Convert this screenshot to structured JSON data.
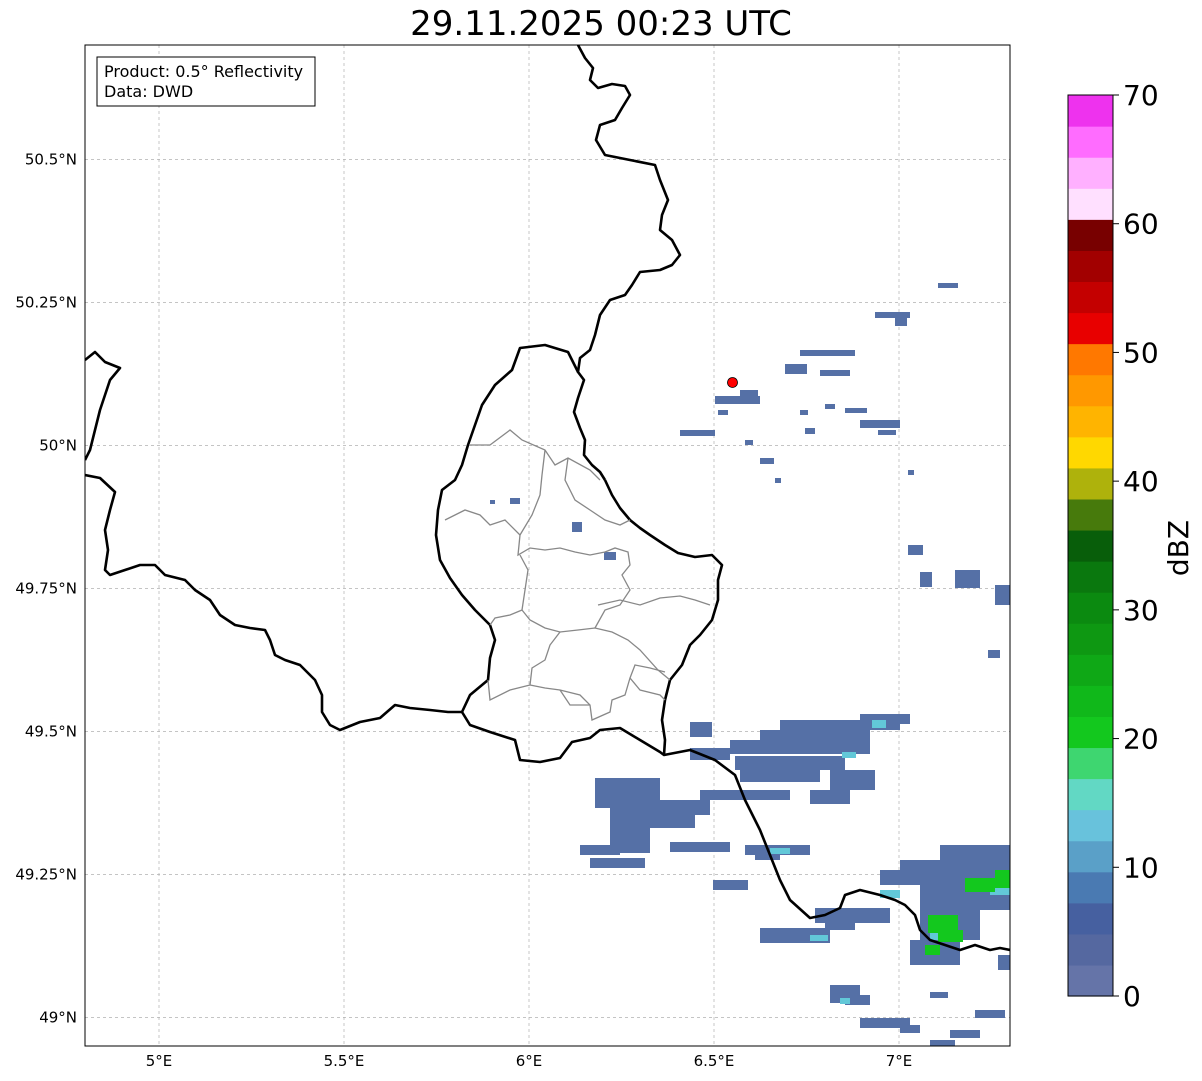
{
  "title": "29.11.2025 00:23 UTC",
  "info_box": {
    "product": "Product: 0.5° Reflectivity",
    "data": "Data: DWD"
  },
  "axes": {
    "lon_range": [
      4.8,
      7.3
    ],
    "lat_range": [
      48.95,
      50.7
    ],
    "lon_ticks": [
      {
        "value": 5.0,
        "label": "5°E"
      },
      {
        "value": 5.5,
        "label": "5.5°E"
      },
      {
        "value": 6.0,
        "label": "6°E"
      },
      {
        "value": 6.5,
        "label": "6.5°E"
      },
      {
        "value": 7.0,
        "label": "7°E"
      }
    ],
    "lat_ticks": [
      {
        "value": 49.0,
        "label": "49°N"
      },
      {
        "value": 49.25,
        "label": "49.25°N"
      },
      {
        "value": 49.5,
        "label": "49.5°N"
      },
      {
        "value": 49.75,
        "label": "49.75°N"
      },
      {
        "value": 50.0,
        "label": "50°N"
      },
      {
        "value": 50.25,
        "label": "50.25°N"
      },
      {
        "value": 50.5,
        "label": "50.5°N"
      }
    ],
    "grid": true
  },
  "radar_site": {
    "lon": 6.55,
    "lat": 50.11,
    "color": "#ff0000"
  },
  "colorbar": {
    "label": "dBZ",
    "range": [
      0,
      70
    ],
    "tick_labels": [
      "0",
      "10",
      "20",
      "30",
      "40",
      "50",
      "60",
      "70"
    ],
    "colors": [
      "#6574a8",
      "#5568a0",
      "#4660a0",
      "#4a7ab2",
      "#5aa0c8",
      "#68c2dc",
      "#62d8c4",
      "#3ed670",
      "#13c81e",
      "#10b81a",
      "#0fa816",
      "#0e9812",
      "#0b8a10",
      "#0a780e",
      "#085e0a",
      "#477a0c",
      "#aeb20c",
      "#ffd800",
      "#ffb400",
      "#ff9800",
      "#ff7800",
      "#e80000",
      "#c40000",
      "#a20000",
      "#780000",
      "#ffe0ff",
      "#ffb0ff",
      "#ff6cff",
      "#ee32ee"
    ]
  }
}
